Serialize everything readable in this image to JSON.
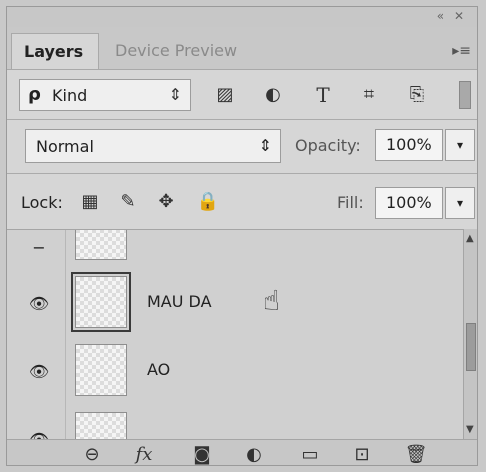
{
  "tabs": {
    "active_label": "Layers",
    "inactive_label": "Device Preview",
    "menu_icon": "panel-menu-icon",
    "menu_glyph": "▸≡"
  },
  "filter": {
    "search_glyph": "ρ",
    "kind_label": "Kind",
    "kind_arrows": "⇕",
    "icons": [
      {
        "name": "pixel-layer-filter-icon",
        "glyph": "▨"
      },
      {
        "name": "adjustment-layer-filter-icon",
        "glyph": "◐"
      },
      {
        "name": "type-layer-filter-icon",
        "glyph": "T"
      },
      {
        "name": "shape-layer-filter-icon",
        "glyph": "⌗"
      },
      {
        "name": "smart-object-filter-icon",
        "glyph": "⎘"
      }
    ]
  },
  "blend": {
    "mode": "Normal",
    "arrows": "⇕",
    "opacity_label": "Opacity:",
    "opacity_value": "100%"
  },
  "lock": {
    "label": "Lock:",
    "icons": [
      {
        "name": "lock-transparent-pixels-icon",
        "glyph": "▦"
      },
      {
        "name": "lock-image-pixels-icon",
        "glyph": "✎"
      },
      {
        "name": "lock-position-icon",
        "glyph": "✥"
      },
      {
        "name": "lock-all-icon",
        "glyph": "🔒"
      }
    ],
    "fill_label": "Fill:",
    "fill_value": "100%"
  },
  "layers": [
    {
      "name": "MAU DA",
      "visible": true,
      "selected": true
    },
    {
      "name": "AO",
      "visible": true,
      "selected": false
    }
  ],
  "bottom_icons": [
    {
      "name": "link-layers-icon",
      "glyph": "⊖"
    },
    {
      "name": "layer-style-fx-icon",
      "glyph": "fx"
    },
    {
      "name": "layer-mask-icon",
      "glyph": "◙"
    },
    {
      "name": "adjustment-layer-icon",
      "glyph": "◐"
    },
    {
      "name": "new-group-icon",
      "glyph": "▭"
    },
    {
      "name": "new-layer-icon",
      "glyph": "⊡"
    },
    {
      "name": "delete-layer-icon",
      "glyph": "🗑"
    }
  ]
}
